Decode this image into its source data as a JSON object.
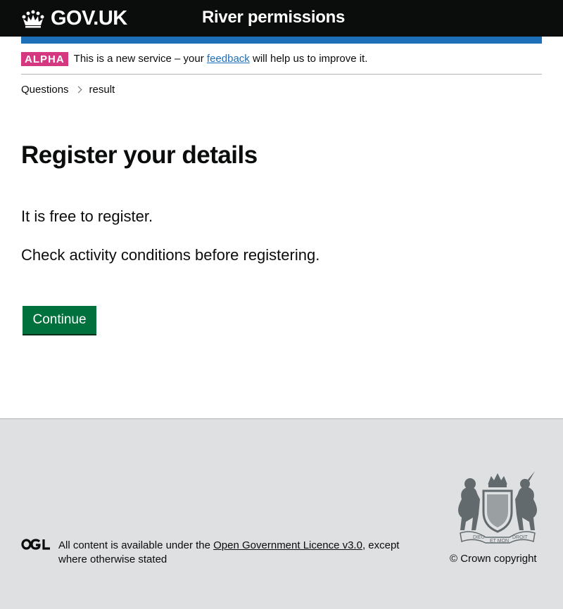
{
  "header": {
    "logo_text": "GOV.UK",
    "service_name": "River permissions"
  },
  "phase_banner": {
    "tag": "ALPHA",
    "text_before": "This is a new service – your ",
    "link_text": "feedback",
    "text_after": " will help us to improve it."
  },
  "breadcrumbs": {
    "items": [
      "Questions",
      "result"
    ]
  },
  "main": {
    "title": "Register your details",
    "paragraphs": [
      "It is free to register.",
      "Check activity conditions before registering."
    ],
    "continue_label": "Continue"
  },
  "footer": {
    "licence_before": "All content is available under the ",
    "licence_link": "Open Government Licence v3.0",
    "licence_after": ", except where otherwise stated",
    "copyright": "© Crown copyright",
    "crest_text": {
      "motto_left": "DIEU",
      "motto_right": "DROIT",
      "motto_center": "ET MON"
    }
  },
  "colors": {
    "header_bg": "#0b0c0c",
    "blue_bar": "#1d70b8",
    "alpha_tag": "#d53880",
    "button": "#00703c",
    "footer_bg": "#dee0e2",
    "crest": "#626a6e"
  },
  "icons": [
    "crown-icon",
    "chevron-right-icon",
    "ogl-logo",
    "royal-coat-of-arms-crest"
  ]
}
